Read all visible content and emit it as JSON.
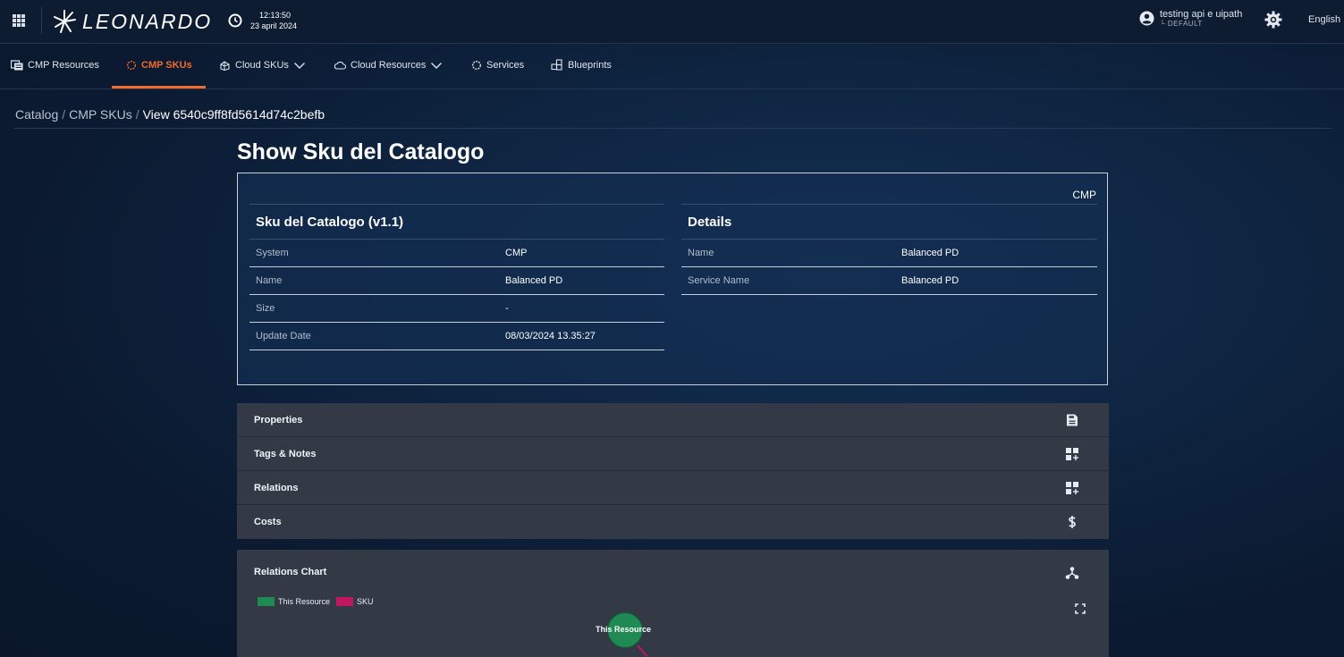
{
  "header": {
    "logo_text": "LEONARDO",
    "clock_time": "12:13:50",
    "clock_date": "23 april 2024",
    "user_name": "testing api e uipath",
    "user_tenant": "└ DEFAULT",
    "language": "English"
  },
  "nav": {
    "items": [
      {
        "label": "CMP Resources",
        "icon": "cmp-resources-icon"
      },
      {
        "label": "CMP SKUs",
        "icon": "sku-gear-icon",
        "active": true
      },
      {
        "label": "Cloud SKUs",
        "icon": "cloud-sku-icon",
        "dropdown": true
      },
      {
        "label": "Cloud Resources",
        "icon": "cloud-icon",
        "dropdown": true
      },
      {
        "label": "Services",
        "icon": "services-gear-icon"
      },
      {
        "label": "Blueprints",
        "icon": "blueprints-icon"
      }
    ]
  },
  "breadcrumb": {
    "root": "Catalog",
    "section": "CMP SKUs",
    "current": "View 6540c9ff8fd5614d74c2befb"
  },
  "page": {
    "title": "Show Sku del Catalogo"
  },
  "card": {
    "tag": "CMP",
    "left_title": "Sku del Catalogo (v1.1)",
    "left_rows": [
      {
        "key": "System",
        "value": "CMP"
      },
      {
        "key": "Name",
        "value": "Balanced PD"
      },
      {
        "key": "Size",
        "value": "-"
      },
      {
        "key": "Update Date",
        "value": "08/03/2024 13.35:27"
      }
    ],
    "right_title": "Details",
    "right_rows": [
      {
        "key": "Name",
        "value": "Balanced PD"
      },
      {
        "key": "Service Name",
        "value": "Balanced PD"
      }
    ]
  },
  "accordion": [
    {
      "label": "Properties",
      "icon": "document-icon"
    },
    {
      "label": "Tags & Notes",
      "icon": "grid-add-icon"
    },
    {
      "label": "Relations",
      "icon": "grid-add-icon"
    },
    {
      "label": "Costs",
      "icon": "dollar-icon"
    }
  ],
  "relations_chart": {
    "title": "Relations Chart",
    "legend": [
      {
        "label": "This Resource",
        "color": "#1f8a53"
      },
      {
        "label": "SKU",
        "color": "#c0185d"
      }
    ],
    "node_label": "This Resource"
  },
  "colors": {
    "accent": "#f26a2e",
    "background": "#0f2542",
    "panel": "#333a45"
  }
}
